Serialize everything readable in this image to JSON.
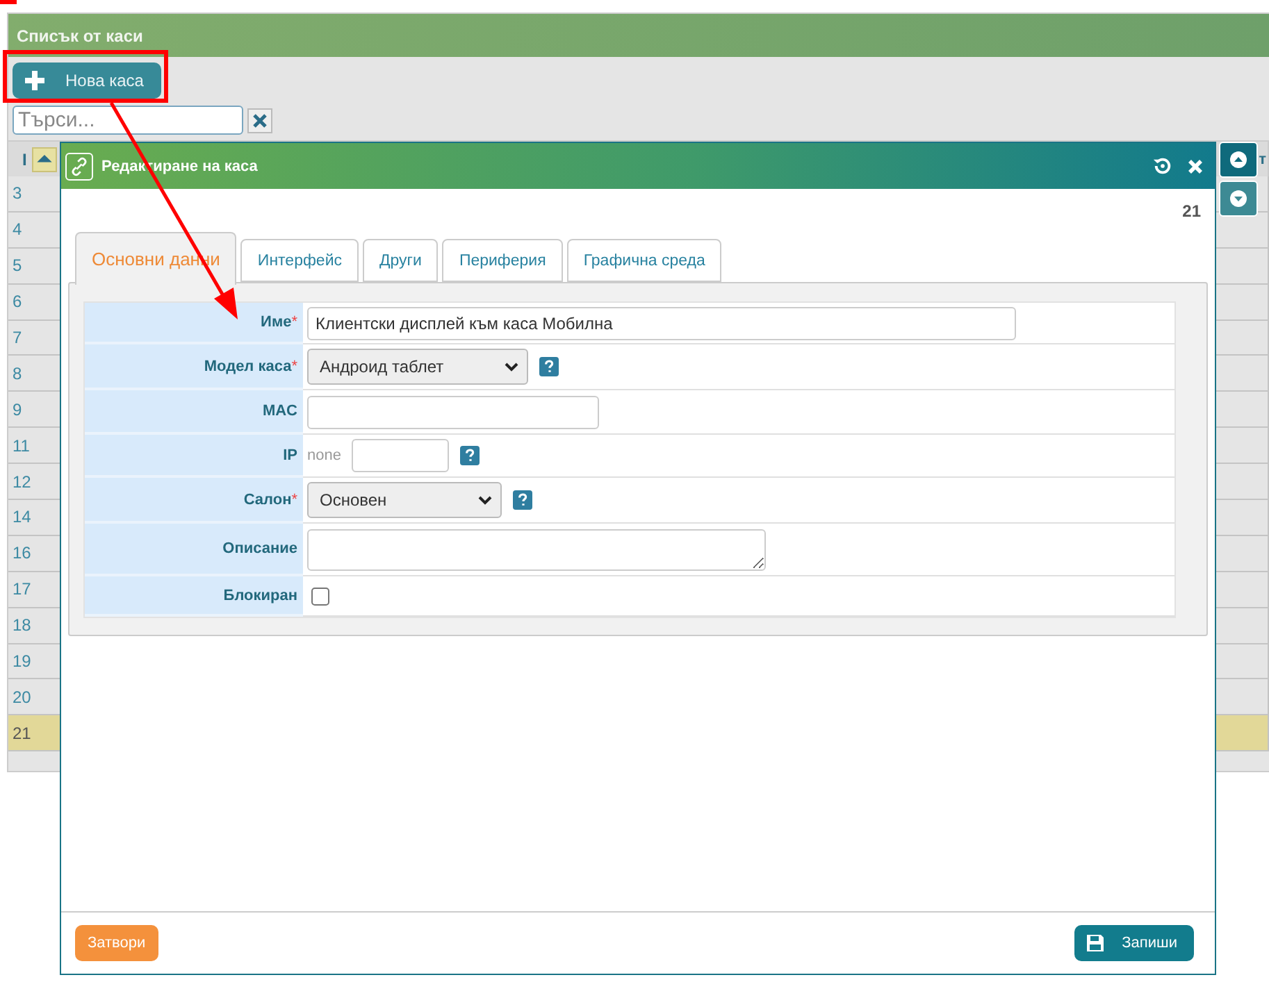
{
  "page": {
    "title": "Списък от каси",
    "new_button": "Нова каса",
    "search": {
      "placeholder": "Търси..."
    },
    "table": {
      "columns": [
        {
          "label": "I",
          "sorted": true
        },
        {
          "label": "т",
          "sorted": false
        }
      ],
      "rows": [
        {
          "id": "3",
          "selected": false
        },
        {
          "id": "4",
          "selected": false
        },
        {
          "id": "5",
          "selected": false
        },
        {
          "id": "6",
          "selected": false
        },
        {
          "id": "7",
          "selected": false
        },
        {
          "id": "8",
          "selected": false
        },
        {
          "id": "9",
          "selected": false
        },
        {
          "id": "11",
          "selected": false
        },
        {
          "id": "12",
          "selected": false
        },
        {
          "id": "14",
          "selected": false
        },
        {
          "id": "16",
          "selected": false
        },
        {
          "id": "17",
          "selected": false
        },
        {
          "id": "18",
          "selected": false
        },
        {
          "id": "19",
          "selected": false
        },
        {
          "id": "20",
          "selected": false
        },
        {
          "id": "21",
          "selected": true
        }
      ]
    }
  },
  "dialog": {
    "title": "Редактиране на каса",
    "record_id": "21",
    "tabs": [
      {
        "label": "Основни данни",
        "selected": true
      },
      {
        "label": "Интерфейс",
        "selected": false
      },
      {
        "label": "Други",
        "selected": false
      },
      {
        "label": "Периферия",
        "selected": false
      },
      {
        "label": "Графична среда",
        "selected": false
      }
    ],
    "fields": [
      {
        "kind": "text",
        "label": "Име",
        "required_mark": "*",
        "value": "Клиентски дисплей към каса Мобилна",
        "help": false
      },
      {
        "kind": "select",
        "label": "Модел каса",
        "required_mark": "*",
        "value": "Андроид таблет",
        "help": true
      },
      {
        "kind": "text",
        "label": "MAC",
        "help": false
      },
      {
        "kind": "ip",
        "label": "IP",
        "prefix": "none",
        "help": true
      },
      {
        "kind": "select",
        "label": "Салон",
        "required_mark": "*",
        "value": "Основен",
        "help": true
      },
      {
        "kind": "textarea",
        "label": "Описание",
        "help": false
      },
      {
        "kind": "checkbox",
        "label": "Блокиран",
        "checked": false,
        "help": false
      }
    ],
    "close_button": "Затвори",
    "save_button": "Запиши"
  }
}
